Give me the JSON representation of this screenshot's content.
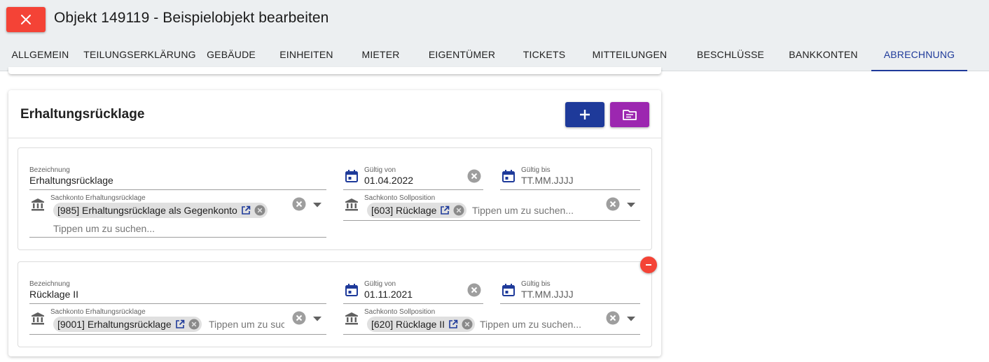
{
  "header": {
    "title": "Objekt 149119 - Beispielobjekt bearbeiten",
    "close_icon": "close-icon"
  },
  "tabs": [
    {
      "label": "ALLGEMEIN",
      "active": false
    },
    {
      "label": "TEILUNGSERKLÄRUNG",
      "active": false
    },
    {
      "label": "GEBÄUDE",
      "active": false
    },
    {
      "label": "EINHEITEN",
      "active": false
    },
    {
      "label": "MIETER",
      "active": false
    },
    {
      "label": "EIGENTÜMER",
      "active": false
    },
    {
      "label": "TICKETS",
      "active": false
    },
    {
      "label": "MITTEILUNGEN",
      "active": false
    },
    {
      "label": "BESCHLÜSSE",
      "active": false
    },
    {
      "label": "BANKKONTEN",
      "active": false
    },
    {
      "label": "ABRECHNUNG",
      "active": true
    }
  ],
  "colors": {
    "primary": "#1e3a9a",
    "danger": "#f44336",
    "purple": "#9c27b0",
    "header_bg": "#eceff1"
  },
  "card": {
    "title": "Erhaltungsrücklage",
    "add_icon": "plus-icon",
    "folder_icon": "document-list-icon"
  },
  "entries": [
    {
      "bezeichnung_label": "Bezeichnung",
      "bezeichnung_value": "Erhaltungsrücklage",
      "gueltig_von_label": "Gültig von",
      "gueltig_von_value": "01.04.2022",
      "gueltig_bis_label": "Gültig bis",
      "gueltig_bis_placeholder": "TT.MM.JJJJ",
      "sachkonto_label": "Sachkonto Erhaltungsrücklage",
      "sachkonto_chip": "[985] Erhaltungsrücklage als Gegenkonto",
      "sachkonto_search_placeholder": "Tippen um zu suchen...",
      "soll_label": "Sachkonto Sollposition",
      "soll_chip": "[603] Rücklage",
      "soll_search_placeholder": "Tippen um zu suchen..."
    },
    {
      "bezeichnung_label": "Bezeichnung",
      "bezeichnung_value": "Rücklage II",
      "gueltig_von_label": "Gültig von",
      "gueltig_von_value": "01.11.2021",
      "gueltig_bis_label": "Gültig bis",
      "gueltig_bis_placeholder": "TT.MM.JJJJ",
      "sachkonto_label": "Sachkonto Erhaltungsrücklage",
      "sachkonto_chip": "[9001] Erhaltungsrücklage",
      "sachkonto_search_placeholder": "Tippen um zu suchen...",
      "soll_label": "Sachkonto Sollposition",
      "soll_chip": "[620] Rücklage II",
      "soll_search_placeholder": "Tippen um zu suchen..."
    }
  ]
}
